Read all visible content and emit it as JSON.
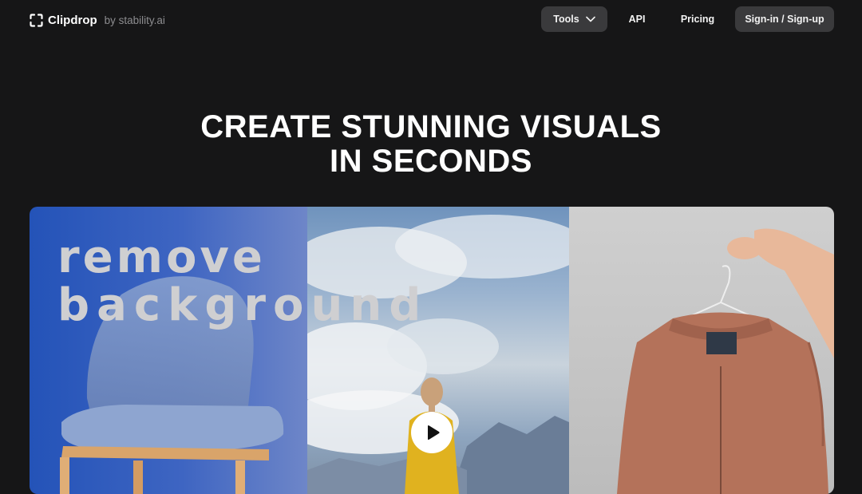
{
  "nav": {
    "brand_name": "Clipdrop",
    "brand_sub": "by stability.ai",
    "tools_label": "Tools",
    "api_label": "API",
    "pricing_label": "Pricing",
    "signin_label": "Sign-in / Sign-up"
  },
  "hero": {
    "title_line1": "CREATE STUNNING VISUALS",
    "title_line2": "IN SECONDS"
  },
  "media": {
    "overlay_line1": "remove",
    "overlay_line2": "background"
  },
  "icons": {
    "logo": "clipdrop-logo-icon",
    "chevron": "chevron-down-icon",
    "play": "play-icon"
  },
  "colors": {
    "background": "#161617",
    "pill": "#3a3a3c",
    "text": "#ffffff",
    "muted": "#8d8d90"
  }
}
